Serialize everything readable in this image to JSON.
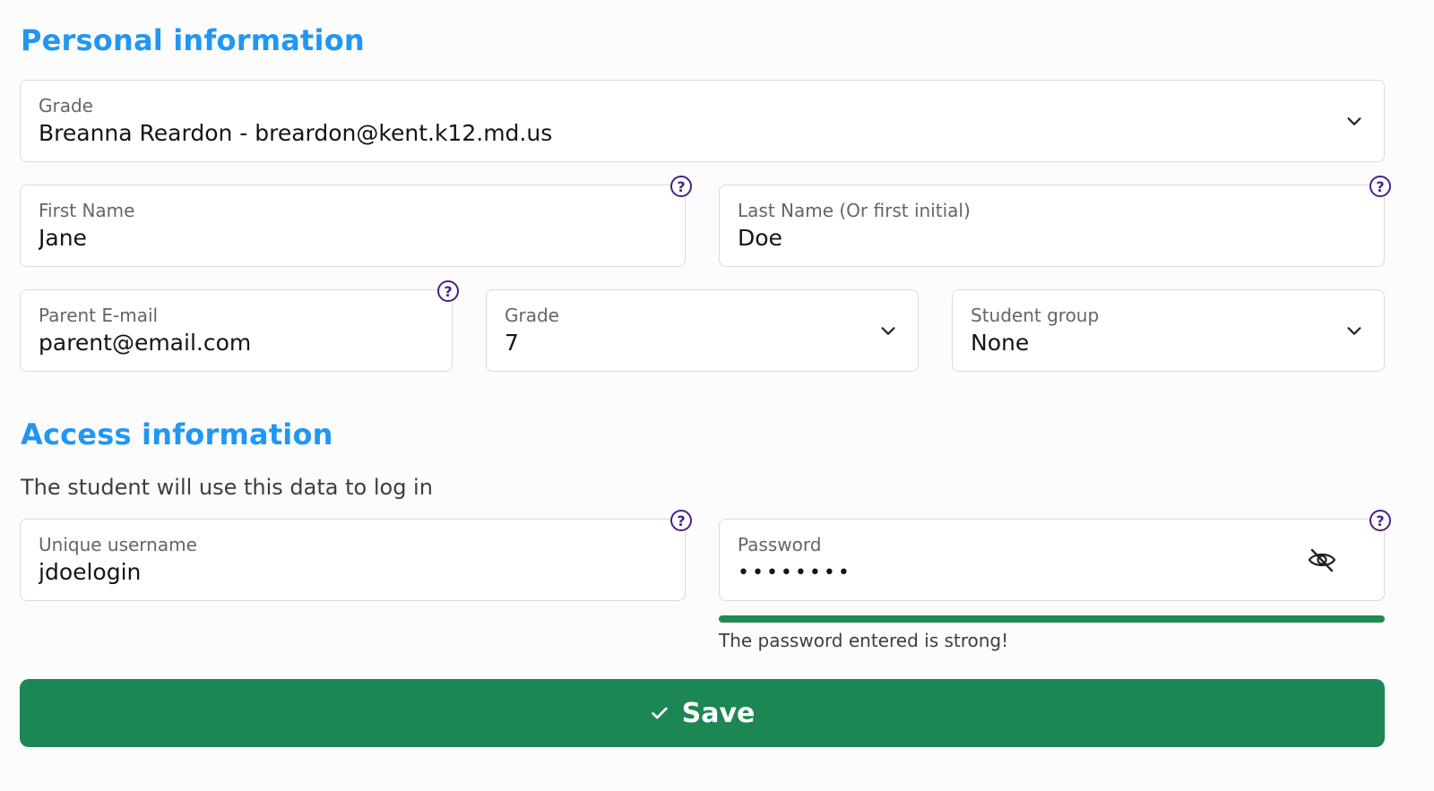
{
  "personal": {
    "title": "Personal information",
    "teacher": {
      "label": "Grade",
      "value": "Breanna Reardon - breardon@kent.k12.md.us"
    },
    "first_name": {
      "label": "First Name",
      "value": "Jane"
    },
    "last_name": {
      "label": "Last Name (Or first initial)",
      "value": "Doe"
    },
    "parent_email": {
      "label": "Parent E-mail",
      "value": "parent@email.com"
    },
    "grade": {
      "label": "Grade",
      "value": "7"
    },
    "student_group": {
      "label": "Student group",
      "value": "None"
    }
  },
  "access": {
    "title": "Access information",
    "subtitle": "The student will use this data to log in",
    "username": {
      "label": "Unique username",
      "value": "jdoelogin"
    },
    "password": {
      "label": "Password",
      "masked_value": "••••••••",
      "toggle_icon": "eye-slash-icon"
    },
    "strength": {
      "message": "The password entered is strong!",
      "level": 1.0,
      "color": "#1f8a54"
    }
  },
  "help_icon": {
    "glyph": "?",
    "color": "#4a1e8c"
  },
  "save_button": {
    "label": "Save",
    "icon": "checkmark-icon",
    "color": "#1c8755"
  },
  "accent_color": "#2196f3"
}
